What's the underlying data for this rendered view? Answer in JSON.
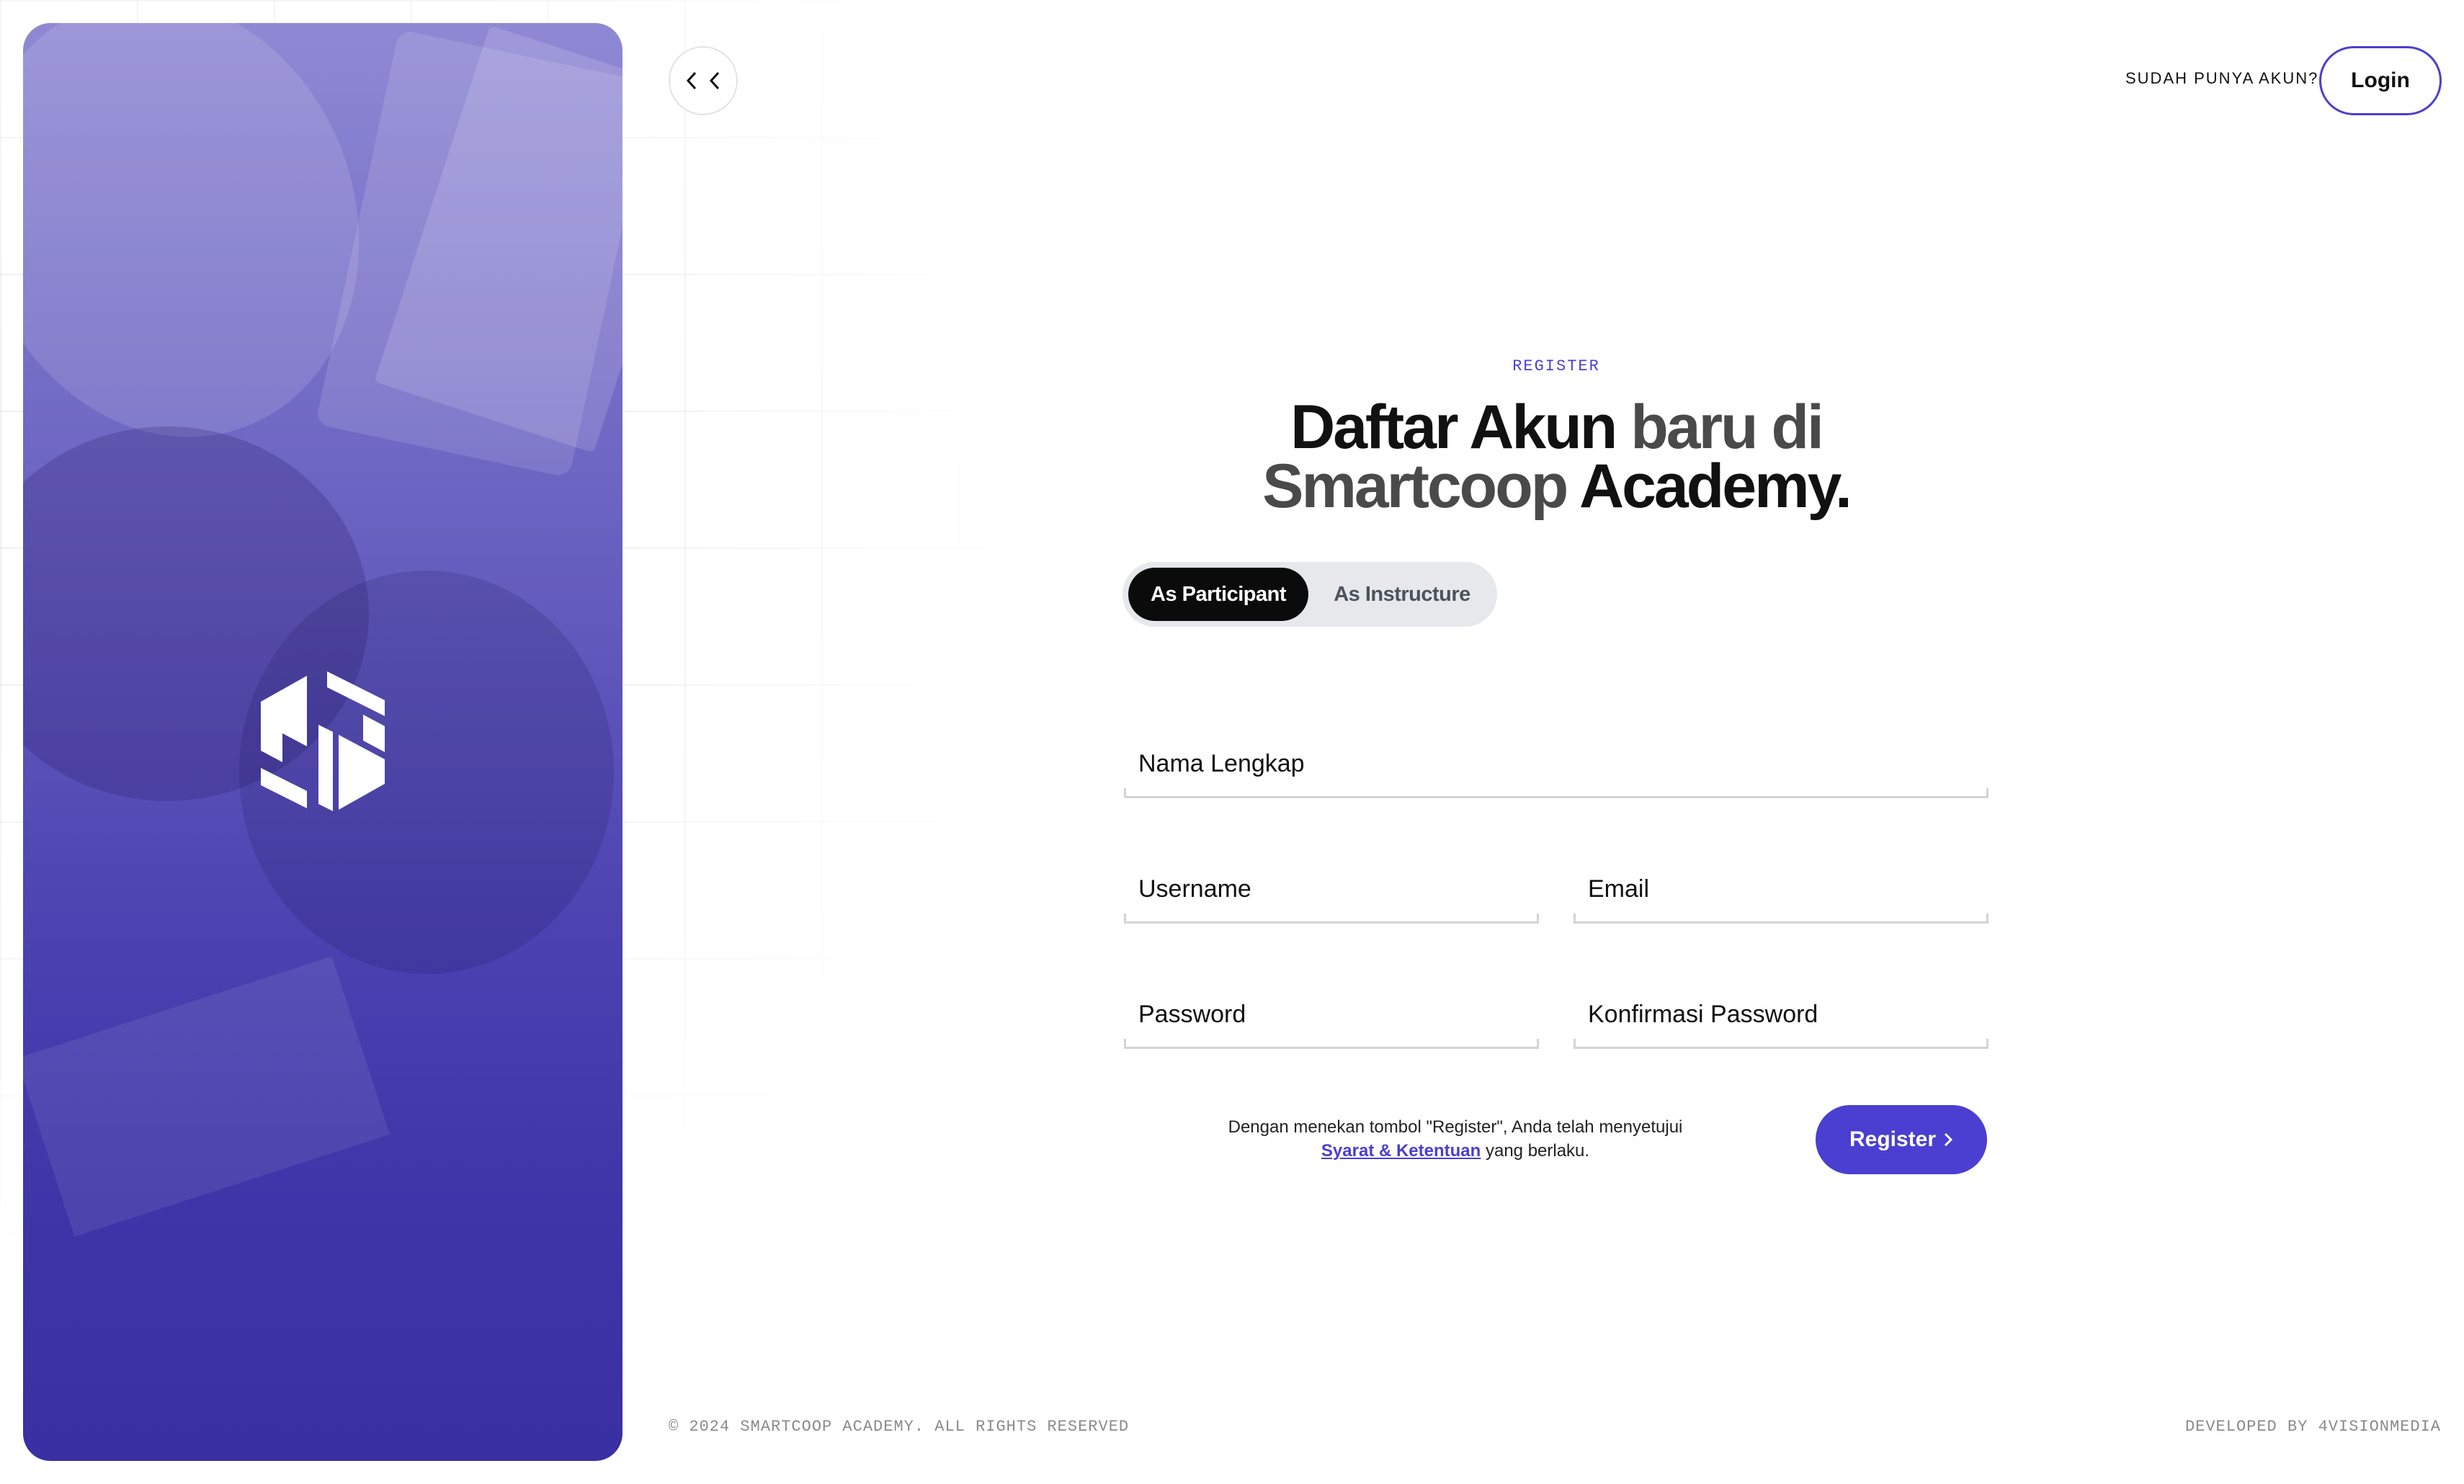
{
  "header": {
    "back_icon": "double-chevron-left-icon",
    "have_account_text": "SUDAH PUNYA AKUN?",
    "login_label": "Login"
  },
  "hero": {
    "logo_icon": "smartcoop-logo-icon",
    "overlay_color": "#4a3fd0"
  },
  "form": {
    "eyebrow": "REGISTER",
    "title_line1_dark": "Daftar Akun ",
    "title_line1_grey": "baru di",
    "title_line2_grey": "Smartcoop ",
    "title_line2_dark": "Academy.",
    "roles": {
      "participant": "As Participant",
      "instructure": "As Instructure",
      "selected": "As Participant"
    },
    "fields": {
      "full_name": {
        "placeholder": "Nama Lengkap",
        "value": ""
      },
      "username": {
        "placeholder": "Username",
        "value": ""
      },
      "email": {
        "placeholder": "Email",
        "value": ""
      },
      "password": {
        "placeholder": "Password",
        "value": ""
      },
      "confirm_password": {
        "placeholder": "Konfirmasi Password",
        "value": ""
      }
    },
    "terms_prefix": "Dengan menekan tombol \"Register\", Anda telah menyetujui ",
    "terms_link": "Syarat & Ketentuan",
    "terms_suffix": " yang berlaku.",
    "register_label": "Register",
    "register_icon": "chevron-right-icon"
  },
  "footer": {
    "copyright": "© 2024 SMARTCOOP ACADEMY. ALL RIGHTS RESERVED",
    "developer": "DEVELOPED BY 4VISIONMEDIA"
  },
  "colors": {
    "accent": "#4a3fd0",
    "active_toggle": "#0b0b0b",
    "toggle_bg": "#e6e8eb"
  }
}
